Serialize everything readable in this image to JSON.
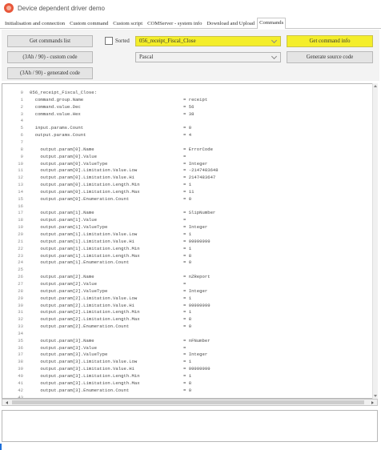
{
  "window": {
    "title": "Device dependent driver demo"
  },
  "tabs": [
    {
      "label": "Initialisation and connection",
      "active": false
    },
    {
      "label": "Custom command",
      "active": false
    },
    {
      "label": "Custom script",
      "active": false
    },
    {
      "label": "COMServer - system info",
      "active": false
    },
    {
      "label": "Download and Upload",
      "active": false
    },
    {
      "label": "Commands",
      "active": true
    }
  ],
  "toolbar": {
    "get_list_label": "Get commands list",
    "sorted_label": "Sorted",
    "command_select_value": "056_receipt_Fiscal_Close",
    "get_info_label": "Get command info",
    "custom_code_label": "(3Ah / 90) - custom code",
    "language_select_value": "Pascal",
    "generate_label": "Generate source code",
    "generated_code_label": "(3Ah / 90) - generated code"
  },
  "colors": {
    "highlight": "#f4ee2a",
    "accent_blue": "#1e6fd9"
  },
  "code_lines": [
    {
      "n": "0",
      "t": "056_receipt_Fiscal_Close:",
      "v": ""
    },
    {
      "n": "1",
      "t": "  command.group.Name",
      "v": "= receipt"
    },
    {
      "n": "2",
      "t": "  command.value.Dec",
      "v": "= 56"
    },
    {
      "n": "3",
      "t": "  command.value.Hex",
      "v": "= 38"
    },
    {
      "n": "4",
      "t": "",
      "v": ""
    },
    {
      "n": "5",
      "t": "  input.params.Count",
      "v": "= 0"
    },
    {
      "n": "6",
      "t": "  output.params.Count",
      "v": "= 4"
    },
    {
      "n": "7",
      "t": "",
      "v": ""
    },
    {
      "n": "8",
      "t": "    output.param[0].Name",
      "v": "= ErrorCode"
    },
    {
      "n": "9",
      "t": "    output.param[0].Value",
      "v": "="
    },
    {
      "n": "10",
      "t": "    output.param[0].ValueType",
      "v": "= Integer"
    },
    {
      "n": "11",
      "t": "    output.param[0].Limitation.Value.Low",
      "v": "= -2147483648"
    },
    {
      "n": "12",
      "t": "    output.param[0].Limitation.Value.Hi",
      "v": "= 2147483647"
    },
    {
      "n": "13",
      "t": "    output.param[0].Limitation.Length.Min",
      "v": "= 1"
    },
    {
      "n": "14",
      "t": "    output.param[0].Limitation.Length.Max",
      "v": "= 11"
    },
    {
      "n": "15",
      "t": "    output.param[0].Enumeration.Count",
      "v": "= 0"
    },
    {
      "n": "16",
      "t": "",
      "v": ""
    },
    {
      "n": "17",
      "t": "    output.param[1].Name",
      "v": "= SlipNumber"
    },
    {
      "n": "18",
      "t": "    output.param[1].Value",
      "v": "="
    },
    {
      "n": "19",
      "t": "    output.param[1].ValueType",
      "v": "= Integer"
    },
    {
      "n": "20",
      "t": "    output.param[1].Limitation.Value.Low",
      "v": "= 1"
    },
    {
      "n": "21",
      "t": "    output.param[1].Limitation.Value.Hi",
      "v": "= 99999999"
    },
    {
      "n": "22",
      "t": "    output.param[1].Limitation.Length.Min",
      "v": "= 1"
    },
    {
      "n": "23",
      "t": "    output.param[1].Limitation.Length.Max",
      "v": "= 8"
    },
    {
      "n": "24",
      "t": "    output.param[1].Enumeration.Count",
      "v": "= 0"
    },
    {
      "n": "25",
      "t": "",
      "v": ""
    },
    {
      "n": "26",
      "t": "    output.param[2].Name",
      "v": "= nZReport"
    },
    {
      "n": "27",
      "t": "    output.param[2].Value",
      "v": "="
    },
    {
      "n": "28",
      "t": "    output.param[2].ValueType",
      "v": "= Integer"
    },
    {
      "n": "29",
      "t": "    output.param[2].Limitation.Value.Low",
      "v": "= 1"
    },
    {
      "n": "30",
      "t": "    output.param[2].Limitation.Value.Hi",
      "v": "= 99999999"
    },
    {
      "n": "31",
      "t": "    output.param[2].Limitation.Length.Min",
      "v": "= 1"
    },
    {
      "n": "32",
      "t": "    output.param[2].Limitation.Length.Max",
      "v": "= 8"
    },
    {
      "n": "33",
      "t": "    output.param[2].Enumeration.Count",
      "v": "= 0"
    },
    {
      "n": "34",
      "t": "",
      "v": ""
    },
    {
      "n": "35",
      "t": "    output.param[3].Name",
      "v": "= nFNumber"
    },
    {
      "n": "36",
      "t": "    output.param[3].Value",
      "v": "="
    },
    {
      "n": "37",
      "t": "    output.param[3].ValueType",
      "v": "= Integer"
    },
    {
      "n": "38",
      "t": "    output.param[3].Limitation.Value.Low",
      "v": "= 1"
    },
    {
      "n": "39",
      "t": "    output.param[3].Limitation.Value.Hi",
      "v": "= 99999999"
    },
    {
      "n": "40",
      "t": "    output.param[3].Limitation.Length.Min",
      "v": "= 1"
    },
    {
      "n": "41",
      "t": "    output.param[3].Limitation.Length.Max",
      "v": "= 8"
    },
    {
      "n": "42",
      "t": "    output.param[3].Enumeration.Count",
      "v": "= 0"
    },
    {
      "n": "43",
      "t": "",
      "v": ""
    }
  ]
}
